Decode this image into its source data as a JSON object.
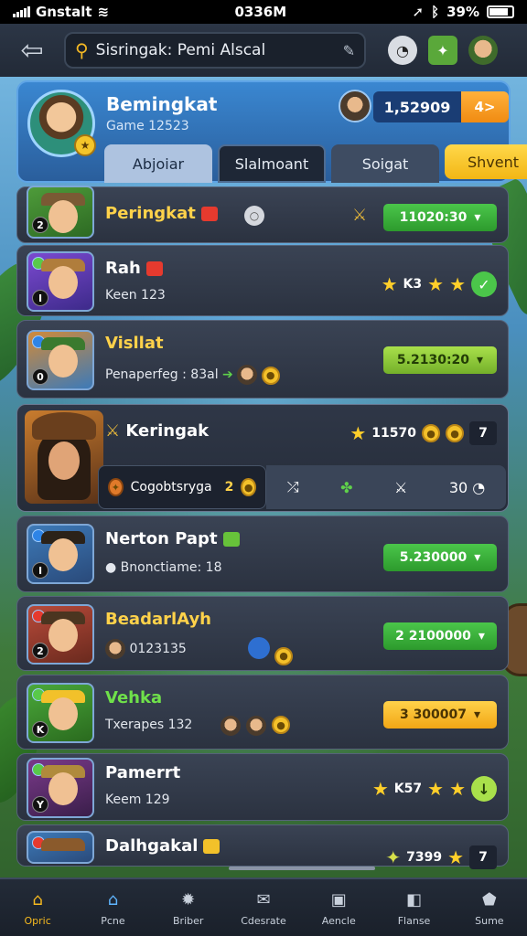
{
  "status": {
    "carrier": "Gnstalt",
    "time": "0336M",
    "battery": "39%"
  },
  "topbar": {
    "search_text": "Sisringak: Pemi Alscal"
  },
  "header": {
    "name": "Bemingkat",
    "subtitle": "Game 12523",
    "score": "1,52909",
    "score_extra": "4>",
    "tabs": [
      "Abjoiar",
      "Slalmoant",
      "Soigat",
      "Shvent"
    ]
  },
  "rows": [
    {
      "name": "Peringkat",
      "rank": "2",
      "value": "11020:30",
      "style": "green"
    },
    {
      "name": "Rah",
      "sub": "Keen 123",
      "rank": "I",
      "stars_text": "K3"
    },
    {
      "name": "Visllat",
      "sub": "Penaperfeg : 83al",
      "rank": "0",
      "value": "5.2130:20",
      "style": "lime"
    },
    {
      "name": "Keringak",
      "count": "11570",
      "pill": "7",
      "sub_panel": "Cogobtsryga",
      "sub_value": "2",
      "strip_last": "30"
    },
    {
      "name": "Nerton Papt",
      "sub": "Bnonctiame: 18",
      "rank": "I",
      "value": "5.230000",
      "style": "green"
    },
    {
      "name": "BeadarlAyh",
      "sub": "0123135",
      "rank": "2",
      "value": "2 2100000",
      "style": "green"
    },
    {
      "name": "Vehka",
      "sub": "Txerapes 132",
      "rank": "K",
      "value": "3 300007",
      "style": "gold"
    },
    {
      "name": "Pamerrt",
      "sub": "Keem 129",
      "rank": "Y",
      "stars_text": "K57"
    },
    {
      "name": "Dalhgakal",
      "count": "7399",
      "pill": "7"
    }
  ],
  "nav": [
    "Opric",
    "Pcne",
    "Briber",
    "Cdesrate",
    "Aencle",
    "Flanse",
    "Sume"
  ],
  "colors": {
    "accent": "#f5b91f",
    "panel": "#2b3240",
    "header": "#3a87d1"
  }
}
